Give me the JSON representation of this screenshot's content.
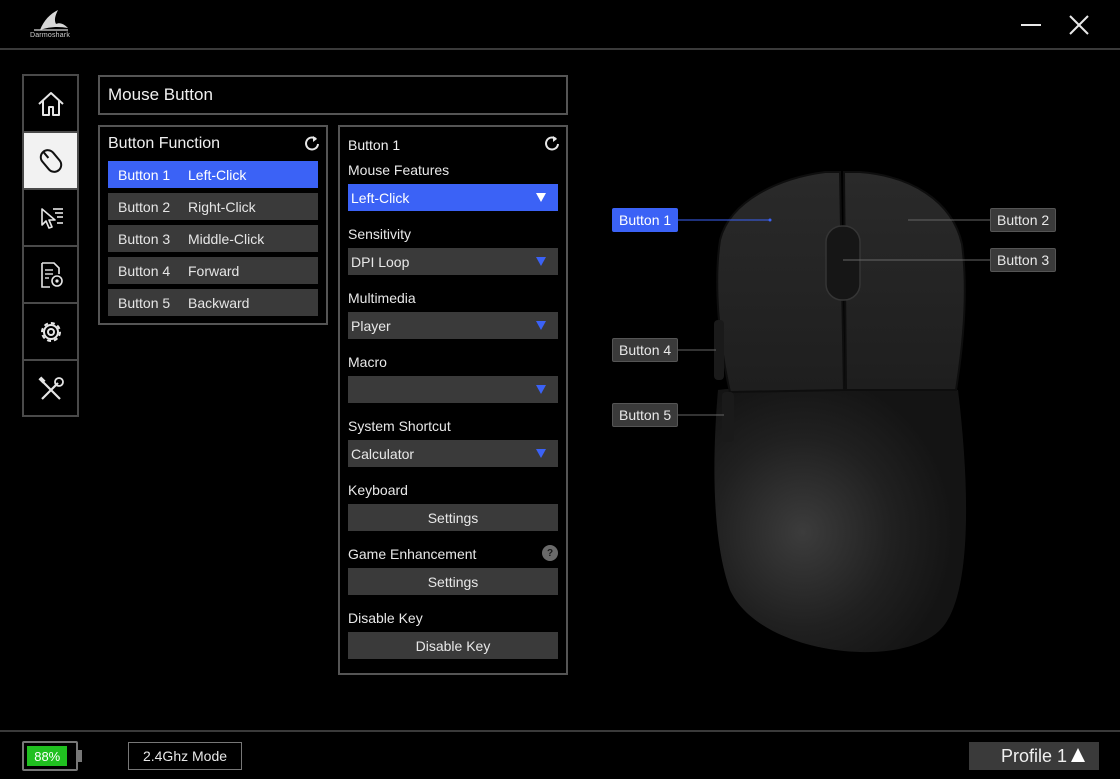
{
  "app": {
    "logo_text": "Darmoshark"
  },
  "window": {
    "minimize_icon": "minimize-icon",
    "close_icon": "close-icon"
  },
  "sidebar": {
    "items": [
      {
        "name": "home",
        "icon": "home-icon",
        "active": false
      },
      {
        "name": "mouse-button",
        "icon": "mouse-icon",
        "active": true
      },
      {
        "name": "pointer",
        "icon": "cursor-settings-icon",
        "active": false
      },
      {
        "name": "config",
        "icon": "document-gear-icon",
        "active": false
      },
      {
        "name": "settings",
        "icon": "gear-icon",
        "active": false
      },
      {
        "name": "tools",
        "icon": "wrench-screwdriver-icon",
        "active": false
      }
    ]
  },
  "header": {
    "title": "Mouse Button"
  },
  "button_function": {
    "title": "Button Function",
    "rows": [
      {
        "key": "Button 1",
        "value": "Left-Click",
        "selected": true
      },
      {
        "key": "Button 2",
        "value": "Right-Click",
        "selected": false
      },
      {
        "key": "Button 3",
        "value": "Middle-Click",
        "selected": false
      },
      {
        "key": "Button 4",
        "value": "Forward",
        "selected": false
      },
      {
        "key": "Button 5",
        "value": "Backward",
        "selected": false
      }
    ]
  },
  "config": {
    "title": "Button 1",
    "mouse_features": {
      "label": "Mouse Features",
      "value": "Left-Click"
    },
    "sensitivity": {
      "label": "Sensitivity",
      "value": "DPI Loop"
    },
    "multimedia": {
      "label": "Multimedia",
      "value": "Player"
    },
    "macro": {
      "label": "Macro",
      "value": ""
    },
    "system_shortcut": {
      "label": "System Shortcut",
      "value": "Calculator"
    },
    "keyboard": {
      "label": "Keyboard",
      "button": "Settings"
    },
    "game_enhancement": {
      "label": "Game Enhancement",
      "button": "Settings",
      "help": "?"
    },
    "disable_key": {
      "label": "Disable Key",
      "button": "Disable Key"
    }
  },
  "mouse_callouts": {
    "b1": "Button 1",
    "b2": "Button 2",
    "b3": "Button 3",
    "b4": "Button 4",
    "b5": "Button 5"
  },
  "status": {
    "battery": "88%",
    "battery_level": 0.88,
    "mode": "2.4Ghz Mode",
    "profile": "Profile 1"
  },
  "colors": {
    "accent": "#3b62f6",
    "battery": "#20c020",
    "panel": "#3a3a3a",
    "border": "#555555"
  }
}
